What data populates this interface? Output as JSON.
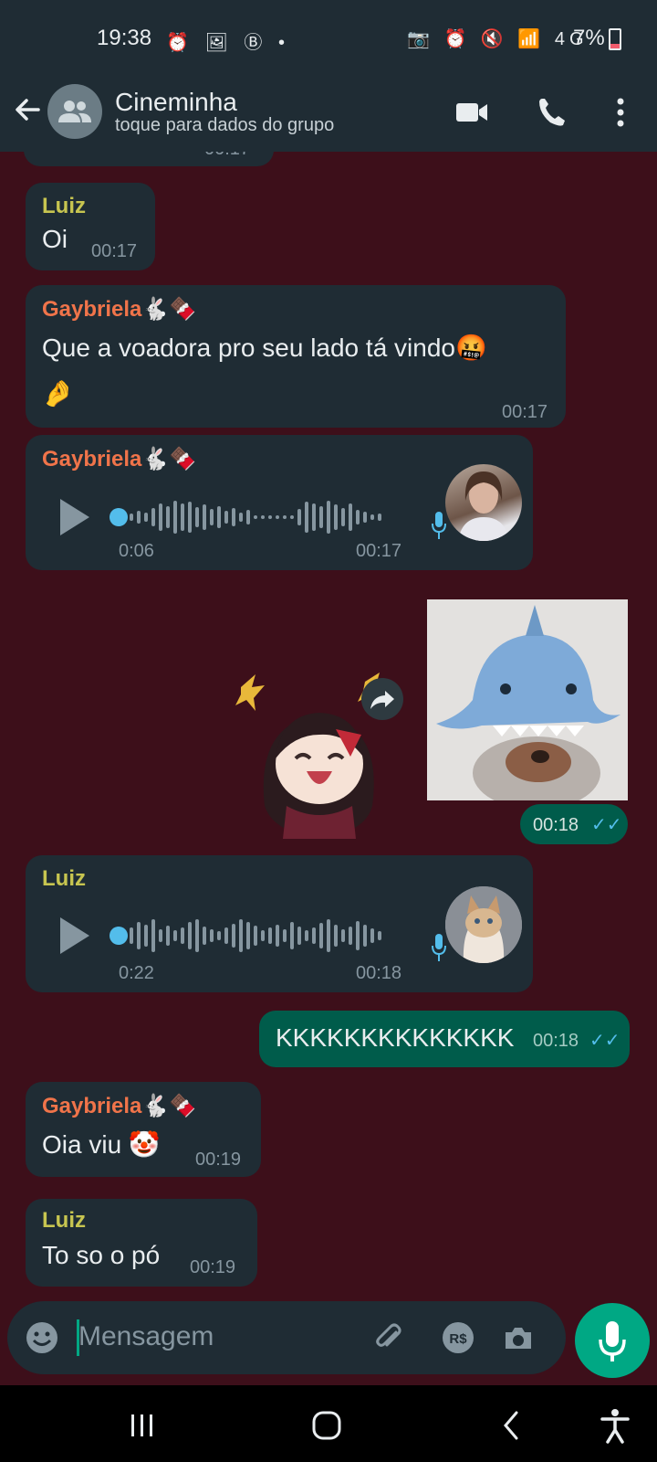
{
  "status": {
    "time": "19:38",
    "left_icons": "⏰ 🖼 Ⓑ •",
    "right_icons": "📷 ⏰ 🔇 📶 4G",
    "battery": "7%",
    "battery_color": "#f15c6d"
  },
  "header": {
    "title": "Cineminha",
    "subtitle": "toque para dados do grupo"
  },
  "messages": {
    "m0": {
      "time": "00:17"
    },
    "m1": {
      "sender": "Luiz",
      "text": "Oi",
      "time": "00:17"
    },
    "m2": {
      "sender": "Gaybriela🐇🍫",
      "text_line1": "Que a voadora pro seu lado tá vindo🤬",
      "text_line2": "🤌",
      "time": "00:17"
    },
    "m3": {
      "sender": "Gaybriela🐇🍫",
      "duration": "0:06",
      "time": "00:17",
      "progress": 0
    },
    "m4": {
      "time": "00:18",
      "read_receipt": "✓✓"
    },
    "m5": {
      "sender": "Luiz",
      "duration": "0:22",
      "time": "00:18",
      "progress": 0
    },
    "m6": {
      "text": "KKKKKKKKKKKKKK",
      "time": "00:18",
      "read_receipt": "✓✓"
    },
    "m7": {
      "sender": "Gaybriela🐇🍫",
      "text": "Oia viu 🤡",
      "time": "00:19"
    },
    "m8": {
      "sender": "Luiz",
      "text": "To so o pó",
      "time": "00:19"
    }
  },
  "composer": {
    "placeholder": "Mensagem",
    "emoji_icon": "emoji-icon",
    "attach_icon": "paperclip-icon",
    "pay_icon": "R$",
    "camera_icon": "camera-icon"
  },
  "colors": {
    "background": "#3d0f1a",
    "bubble_in": "#1f2c34",
    "bubble_out": "#005c4b",
    "accent": "#00a884"
  }
}
